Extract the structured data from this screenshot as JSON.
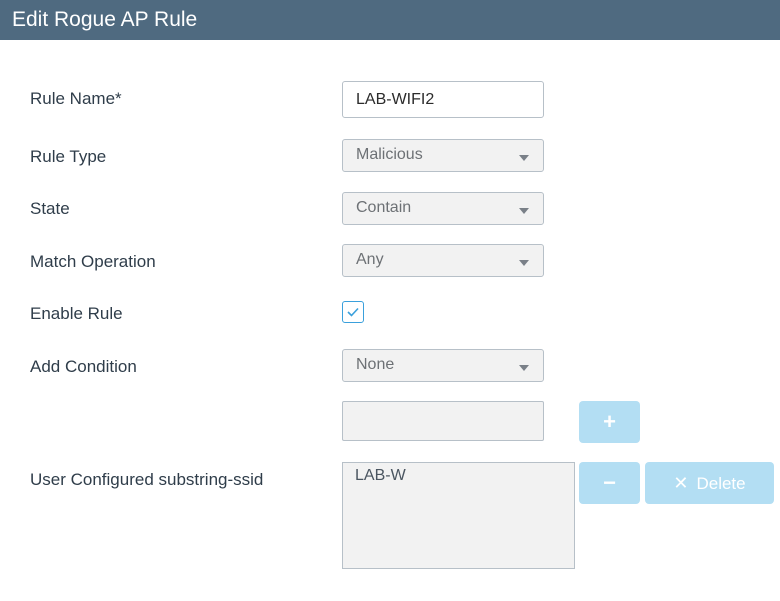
{
  "dialog": {
    "title": "Edit Rogue AP Rule"
  },
  "form": {
    "rule_name": {
      "label": "Rule Name*",
      "value": "LAB-WIFI2"
    },
    "rule_type": {
      "label": "Rule Type",
      "value": "Malicious"
    },
    "state": {
      "label": "State",
      "value": "Contain"
    },
    "match_operation": {
      "label": "Match Operation",
      "value": "Any"
    },
    "enable_rule": {
      "label": "Enable Rule",
      "checked": true
    },
    "add_condition": {
      "label": "Add Condition",
      "value": "None"
    },
    "condition_value": {
      "value": ""
    },
    "substring_ssid": {
      "label": "User Configured substring-ssid",
      "items": [
        "LAB-W"
      ]
    }
  },
  "buttons": {
    "add": {
      "glyph": "+"
    },
    "remove": {
      "glyph": "−"
    },
    "delete": {
      "icon": "✕",
      "label": "Delete"
    }
  },
  "colors": {
    "titlebar": "#4f6a80",
    "button_disabled": "#b3def3",
    "checkbox_accent": "#3aa0dc"
  }
}
